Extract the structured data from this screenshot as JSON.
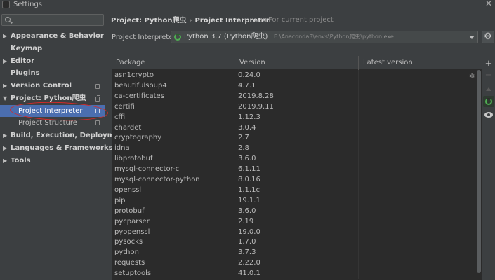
{
  "window": {
    "title": "Settings",
    "close_glyph": "✕"
  },
  "search": {
    "value": "",
    "placeholder": ""
  },
  "nav": {
    "items": [
      {
        "label": "Appearance & Behavior",
        "arrow": "▶"
      },
      {
        "label": "Keymap"
      },
      {
        "label": "Editor",
        "arrow": "▶"
      },
      {
        "label": "Plugins"
      },
      {
        "label": "Version Control",
        "arrow": "▶"
      },
      {
        "label": "Project: Python爬虫",
        "arrow": "▼"
      },
      {
        "label": "Build, Execution, Deployment",
        "arrow": "▶"
      },
      {
        "label": "Languages & Frameworks",
        "arrow": "▶"
      },
      {
        "label": "Tools",
        "arrow": "▶"
      }
    ],
    "sub_items": [
      {
        "label": "Project Interpreter",
        "selected": true
      },
      {
        "label": "Project Structure"
      }
    ]
  },
  "breadcrumb": {
    "project": "Project: Python爬虫",
    "separator": "›",
    "page": "Project Interpreter"
  },
  "scope": {
    "label": "For current project"
  },
  "interpreter": {
    "label": "Project Interpreter:",
    "name": "Python 3.7 (Python爬虫)",
    "path": "E:\\Anaconda3\\envs\\Python爬虫\\python.exe"
  },
  "toolbar": {
    "gear_glyph": "⚙",
    "add_glyph": "+",
    "remove_glyph": "−"
  },
  "table": {
    "headers": [
      "Package",
      "Version",
      "Latest version"
    ],
    "rows": [
      [
        "asn1crypto",
        "0.24.0",
        ""
      ],
      [
        "beautifulsoup4",
        "4.7.1",
        ""
      ],
      [
        "ca-certificates",
        "2019.8.28",
        ""
      ],
      [
        "certifi",
        "2019.9.11",
        ""
      ],
      [
        "cffi",
        "1.12.3",
        ""
      ],
      [
        "chardet",
        "3.0.4",
        ""
      ],
      [
        "cryptography",
        "2.7",
        ""
      ],
      [
        "idna",
        "2.8",
        ""
      ],
      [
        "libprotobuf",
        "3.6.0",
        ""
      ],
      [
        "mysql-connector-c",
        "6.1.11",
        ""
      ],
      [
        "mysql-connector-python",
        "8.0.16",
        ""
      ],
      [
        "openssl",
        "1.1.1c",
        ""
      ],
      [
        "pip",
        "19.1.1",
        ""
      ],
      [
        "protobuf",
        "3.6.0",
        ""
      ],
      [
        "pycparser",
        "2.19",
        ""
      ],
      [
        "pyopenssl",
        "19.0.0",
        ""
      ],
      [
        "pysocks",
        "1.7.0",
        ""
      ],
      [
        "python",
        "3.7.3",
        ""
      ],
      [
        "requests",
        "2.22.0",
        ""
      ],
      [
        "setuptools",
        "41.0.1",
        ""
      ]
    ]
  },
  "colors": {
    "background": "#3c3f41",
    "table_bg": "#2b2b2b",
    "selection": "#4b6eaf",
    "annotation_red": "#d42a2a",
    "status_green": "#4fae52"
  }
}
